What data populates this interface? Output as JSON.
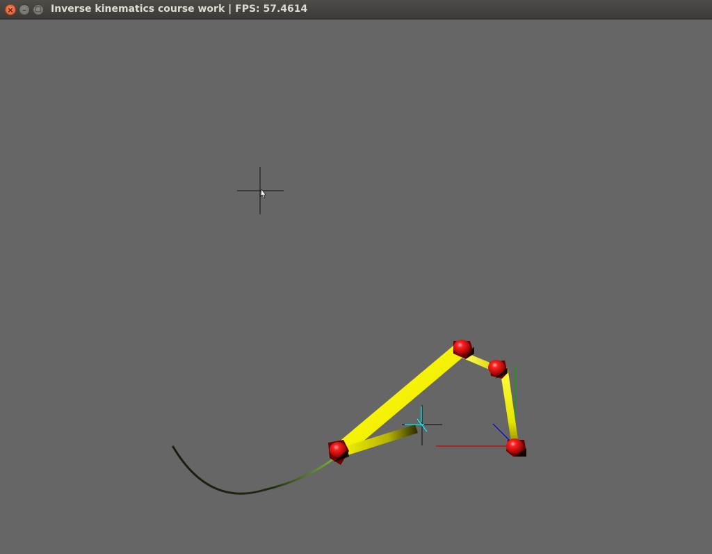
{
  "window": {
    "title": "Inverse kinematics course work | FPS: 57.4614",
    "buttons": {
      "close_icon": "×",
      "minimize_icon": "–",
      "maximize_icon": "□"
    }
  },
  "scene": {
    "background_color": "#666666",
    "bone_color": "#ffff00",
    "joint_color": "#ff0000",
    "trajectory_color": "#6a9a1e",
    "axis_colors": {
      "x": "#cc0000",
      "y": "#00aa00",
      "z": "#0000cc"
    },
    "target_marker_color": "#00ffff",
    "cursor_marker_color": "#000000",
    "joint_count": 4,
    "bone_count": 4
  }
}
